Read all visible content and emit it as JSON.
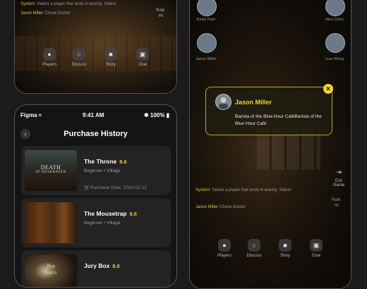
{
  "left_top_phone": {
    "chat": [
      {
        "who": "System:",
        "msg": "Select a player that ends in enemy. Select"
      },
      {
        "who": "Jason Miller",
        "msg": "Chose Doctor"
      }
    ],
    "corner_label": "Role\nHi",
    "dock": [
      {
        "label": "Players",
        "icon": "players-icon"
      },
      {
        "label": "Discuss",
        "icon": "discuss-icon"
      },
      {
        "label": "Story",
        "icon": "story-icon"
      },
      {
        "label": "Clue",
        "icon": "clue-icon"
      }
    ]
  },
  "purchase_phone": {
    "status": {
      "carrier": "Figma",
      "time": "9:41 AM",
      "battery": "100%"
    },
    "title": "Purchase History",
    "items": [
      {
        "name": "The Throne",
        "rating": "8.6",
        "meta": "Beginner • Village",
        "date": "Purchase Date: 2024-02-12",
        "cover_title": "DEATH",
        "cover_sub": "AT DUSKHAVEN"
      },
      {
        "name": "The Mousetrap",
        "rating": "8.6",
        "meta": "Beginner • Village",
        "date": "",
        "cover_title": "",
        "cover_sub": ""
      },
      {
        "name": "Jury Box",
        "rating": "8.6",
        "meta": "",
        "date": "",
        "cover_title": "Ten",
        "cover_sub": "years"
      }
    ]
  },
  "right_phone": {
    "players": [
      {
        "name": "Emily Park"
      },
      {
        "name": "Alex Chen"
      },
      {
        "name": "Jason Miller"
      },
      {
        "name": "Lisa Wang"
      }
    ],
    "chat": [
      {
        "who": "System:",
        "msg": "Select a player that ends in enemy. Select"
      },
      {
        "who": "Jason Miller",
        "msg": "Chose Doctor"
      }
    ],
    "side_buttons": [
      {
        "label": "Exit Game"
      },
      {
        "label": "Role\nHi"
      }
    ],
    "dock": [
      {
        "label": "Players"
      },
      {
        "label": "Discuss"
      },
      {
        "label": "Story"
      },
      {
        "label": "Clue"
      }
    ],
    "modal": {
      "name": "Jason Miller",
      "description": "Barista of the Blue Hour CaféBarista of the Blue Hour Café",
      "close": "✕"
    }
  },
  "colors": {
    "accent": "#f1d534",
    "background": "#1b1b1b",
    "card": "#232323"
  }
}
